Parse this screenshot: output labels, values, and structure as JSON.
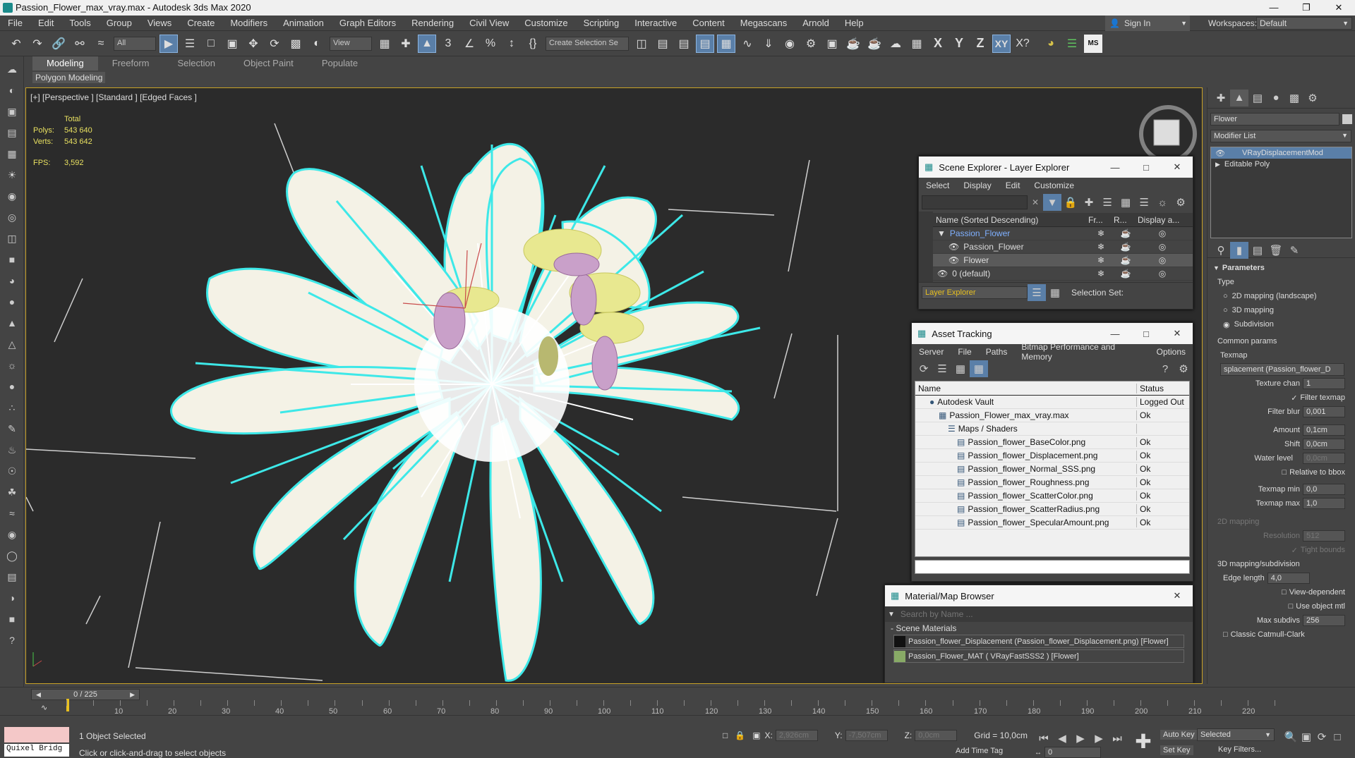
{
  "app": {
    "title": "Passion_Flower_max_vray.max - Autodesk 3ds Max 2020"
  },
  "menu": [
    "File",
    "Edit",
    "Tools",
    "Group",
    "Views",
    "Create",
    "Modifiers",
    "Animation",
    "Graph Editors",
    "Rendering",
    "Civil View",
    "Customize",
    "Scripting",
    "Interactive",
    "Content",
    "Megascans",
    "Arnold",
    "Help"
  ],
  "account": {
    "sign_in": "Sign In",
    "workspaces_label": "Workspaces:",
    "workspace": "Default"
  },
  "toolbar": {
    "filter": "All",
    "ref_coord": "View",
    "selection_set": "Create Selection Se",
    "axis": [
      "X",
      "Y",
      "Z",
      "XY"
    ]
  },
  "ribbon": {
    "tabs": [
      "Modeling",
      "Freeform",
      "Selection",
      "Object Paint",
      "Populate"
    ],
    "subtab": "Polygon Modeling"
  },
  "viewport": {
    "label": "[+] [Perspective ] [Standard ] [Edged Faces ]",
    "stats": {
      "total": "Total",
      "polys_label": "Polys:",
      "polys": "543 640",
      "verts_label": "Verts:",
      "verts": "543 642",
      "fps_label": "FPS:",
      "fps": "3,592"
    }
  },
  "scene_explorer": {
    "title": "Scene Explorer - Layer Explorer",
    "menu": [
      "Select",
      "Display",
      "Edit",
      "Customize"
    ],
    "columns": [
      "Name (Sorted Descending)",
      "Fr...",
      "R...",
      "Display a..."
    ],
    "rows": [
      {
        "name": "Passion_Flower",
        "level": 0
      },
      {
        "name": "Passion_Flower",
        "level": 1
      },
      {
        "name": "Flower",
        "level": 1
      },
      {
        "name": "0 (default)",
        "level": 0
      }
    ],
    "footer_explorer": "Layer Explorer",
    "footer_selset": "Selection Set:"
  },
  "asset_tracking": {
    "title": "Asset Tracking",
    "menu": [
      "Server",
      "File",
      "Paths",
      "Bitmap Performance and Memory",
      "Options"
    ],
    "columns": [
      "Name",
      "Status"
    ],
    "rows": [
      {
        "name": "Autodesk Vault",
        "status": "Logged Out",
        "level": 0
      },
      {
        "name": "Passion_Flower_max_vray.max",
        "status": "Ok",
        "level": 1
      },
      {
        "name": "Maps / Shaders",
        "status": "",
        "level": 2
      },
      {
        "name": "Passion_flower_BaseColor.png",
        "status": "Ok",
        "level": 3
      },
      {
        "name": "Passion_flower_Displacement.png",
        "status": "Ok",
        "level": 3
      },
      {
        "name": "Passion_flower_Normal_SSS.png",
        "status": "Ok",
        "level": 3
      },
      {
        "name": "Passion_flower_Roughness.png",
        "status": "Ok",
        "level": 3
      },
      {
        "name": "Passion_flower_ScatterColor.png",
        "status": "Ok",
        "level": 3
      },
      {
        "name": "Passion_flower_ScatterRadius.png",
        "status": "Ok",
        "level": 3
      },
      {
        "name": "Passion_flower_SpecularAmount.png",
        "status": "Ok",
        "level": 3
      }
    ]
  },
  "material_browser": {
    "title": "Material/Map Browser",
    "search_placeholder": "Search by Name ...",
    "section": "- Scene Materials",
    "items": [
      "Passion_flower_Displacement (Passion_flower_Displacement.png) [Flower]",
      "Passion_Flower_MAT  ( VRayFastSSS2 )  [Flower]"
    ]
  },
  "command_panel": {
    "object_name": "Flower",
    "modifier_list": "Modifier List",
    "stack": [
      "VRayDisplacementMod",
      "Editable Poly"
    ],
    "parameters": "Parameters",
    "type_label": "Type",
    "types": [
      "2D mapping (landscape)",
      "3D mapping",
      "Subdivision"
    ],
    "common_params": "Common params",
    "texmap_label": "Texmap",
    "texmap": "splacement (Passion_flower_D",
    "texture_chan_label": "Texture chan",
    "texture_chan": "1",
    "filter_texmap": "Filter texmap",
    "filter_blur_label": "Filter blur",
    "filter_blur": "0,001",
    "amount_label": "Amount",
    "amount": "0,1cm",
    "shift_label": "Shift",
    "shift": "0,0cm",
    "water_level_label": "Water level",
    "water_level": "0,0cm",
    "relative_bbox": "Relative to bbox",
    "texmap_min_label": "Texmap min",
    "texmap_min": "0,0",
    "texmap_max_label": "Texmap max",
    "texmap_max": "1,0",
    "mapping2d": "2D mapping",
    "resolution_label": "Resolution",
    "resolution": "512",
    "tight_bounds": "Tight bounds",
    "mapping3d": "3D mapping/subdivision",
    "edge_length_label": "Edge length",
    "edge_length": "4,0",
    "view_dependent": "View-dependent",
    "use_object_mtl": "Use object mtl",
    "max_subdivs_label": "Max subdivs",
    "max_subdivs": "256",
    "classic_cc": "Classic Catmull-Clark"
  },
  "timeline": {
    "frame": "0 / 225",
    "ticks": [
      "10",
      "20",
      "30",
      "40",
      "50",
      "60",
      "70",
      "80",
      "90",
      "100",
      "110",
      "120",
      "130",
      "140",
      "150",
      "160",
      "170",
      "180",
      "190",
      "200",
      "210",
      "220"
    ]
  },
  "status": {
    "quixel": "Quixel Bridg",
    "selected": "1 Object Selected",
    "prompt": "Click or click-and-drag to select objects",
    "x_label": "X:",
    "x": "2,926cm",
    "y_label": "Y:",
    "y": "-7,507cm",
    "z_label": "Z:",
    "z": "0,0cm",
    "grid": "Grid = 10,0cm",
    "add_time_tag": "Add Time Tag",
    "auto_key": "Auto Key",
    "set_key": "Set Key",
    "key_mode": "Selected",
    "key_filters": "Key Filters...",
    "frame_field": "0"
  },
  "colors": {
    "accent": "#5a7fa8",
    "viewport_border": "#c8a227",
    "selection_outline": "#3de8e8",
    "stats": "#e8e060"
  }
}
